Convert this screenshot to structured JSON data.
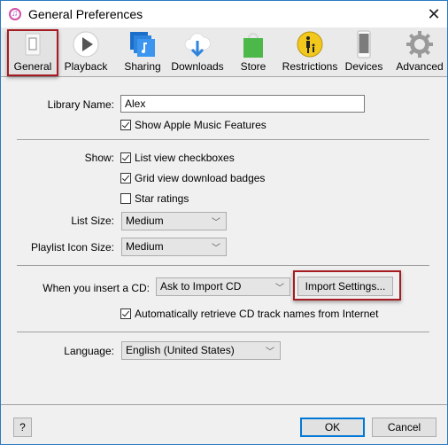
{
  "window": {
    "title": "General Preferences",
    "close_label": "✕",
    "app_icon_glyph": "♫"
  },
  "toolbar": {
    "items": [
      {
        "id": "general",
        "label": "General",
        "icon": "general-switch-icon",
        "selected": true
      },
      {
        "id": "playback",
        "label": "Playback",
        "icon": "play-icon",
        "selected": false
      },
      {
        "id": "sharing",
        "label": "Sharing",
        "icon": "sharing-music-icon",
        "selected": false
      },
      {
        "id": "downloads",
        "label": "Downloads",
        "icon": "cloud-download-icon",
        "selected": false
      },
      {
        "id": "store",
        "label": "Store",
        "icon": "shopping-bag-icon",
        "selected": false
      },
      {
        "id": "restrictions",
        "label": "Restrictions",
        "icon": "parental-restrictions-icon",
        "selected": false
      },
      {
        "id": "devices",
        "label": "Devices",
        "icon": "iphone-icon",
        "selected": false
      },
      {
        "id": "advanced",
        "label": "Advanced",
        "icon": "gear-icon",
        "selected": false
      }
    ]
  },
  "general": {
    "library_name_label": "Library Name:",
    "library_name_value": "Alex",
    "show_apple_music": {
      "label": "Show Apple Music Features",
      "checked": true
    },
    "show_label": "Show:",
    "show_options": [
      {
        "label": "List view checkboxes",
        "checked": true
      },
      {
        "label": "Grid view download badges",
        "checked": true
      },
      {
        "label": "Star ratings",
        "checked": false
      }
    ],
    "list_size_label": "List Size:",
    "list_size_value": "Medium",
    "playlist_icon_size_label": "Playlist Icon Size:",
    "playlist_icon_size_value": "Medium",
    "insert_cd_label": "When you insert a CD:",
    "insert_cd_value": "Ask to Import CD",
    "import_settings_label": "Import Settings...",
    "auto_retrieve": {
      "label": "Automatically retrieve CD track names from Internet",
      "checked": true
    },
    "language_label": "Language:",
    "language_value": "English (United States)"
  },
  "footer": {
    "help_label": "?",
    "ok_label": "OK",
    "cancel_label": "Cancel"
  },
  "colors": {
    "highlight_red": "#a51d22",
    "window_border": "#2b79c2",
    "default_button_border": "#0078d7"
  }
}
